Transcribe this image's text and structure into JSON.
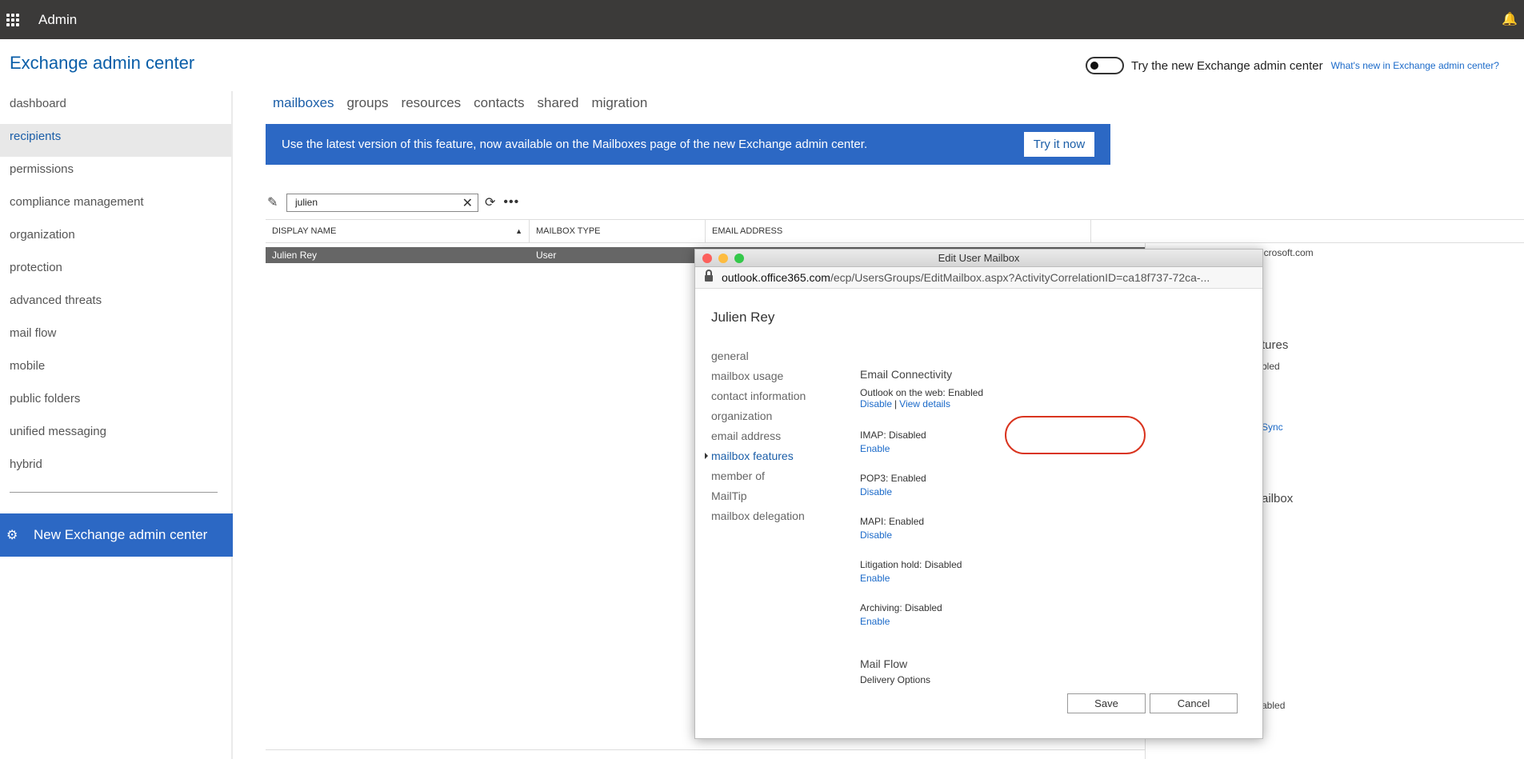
{
  "topbar": {
    "app_title": "Admin",
    "bell_glyph": "🔔"
  },
  "header": {
    "title": "Exchange admin center",
    "toggle_label": "Try the new Exchange admin center",
    "whats_new": "What's new in Exchange admin center?"
  },
  "nav": {
    "items": [
      "dashboard",
      "recipients",
      "permissions",
      "compliance management",
      "organization",
      "protection",
      "advanced threats",
      "mail flow",
      "mobile",
      "public folders",
      "unified messaging",
      "hybrid"
    ],
    "active": "recipients",
    "new_eac": "New Exchange admin center"
  },
  "tabs": {
    "items": [
      "mailboxes",
      "groups",
      "resources",
      "contacts",
      "shared",
      "migration"
    ],
    "active": "mailboxes"
  },
  "banner": {
    "text": "Use the latest version of this feature, now available on the Mailboxes page of the new Exchange admin center.",
    "button": "Try it now"
  },
  "toolbar": {
    "search_value": "julien"
  },
  "table": {
    "columns": [
      "DISPLAY NAME",
      "MAILBOX TYPE",
      "EMAIL ADDRESS"
    ],
    "rows": [
      {
        "display_name": "Julien Rey",
        "mailbox_type": "User"
      }
    ]
  },
  "background_details": {
    "email_partial": "icrosoft.com",
    "features_partial": "tures",
    "enabled_partial": "bled",
    "sync_partial": "Sync",
    "mailbox_partial": "ailbox",
    "enabled_partial_2": "abled"
  },
  "modal": {
    "window_title": "Edit User Mailbox",
    "url_host": "outlook.office365.com",
    "url_path": "/ecp/UsersGroups/EditMailbox.aspx?ActivityCorrelationID=ca18f737-72ca-...",
    "user_name": "Julien Rey",
    "nav_items": [
      "general",
      "mailbox usage",
      "contact information",
      "organization",
      "email address",
      "mailbox features",
      "member of",
      "MailTip",
      "mailbox delegation"
    ],
    "active_nav": "mailbox features",
    "email_connectivity": "Email Connectivity",
    "owa_status": "Outlook on the web: Enabled",
    "owa_disable": "Disable",
    "owa_sep": "|",
    "owa_details": "View details",
    "imap_status": "IMAP: Disabled",
    "imap_action": "Enable",
    "pop3_status": "POP3: Enabled",
    "pop3_action": "Disable",
    "mapi_status": "MAPI: Enabled",
    "mapi_action": "Disable",
    "litigation_status": "Litigation hold: Disabled",
    "litigation_action": "Enable",
    "archiving_status": "Archiving: Disabled",
    "archiving_action": "Enable",
    "mail_flow": "Mail Flow",
    "delivery_options": "Delivery Options",
    "save": "Save",
    "cancel": "Cancel"
  },
  "colors": {
    "accent": "#2c68c4",
    "topbar": "#3b3a39",
    "highlight": "#d9341f",
    "link": "#1b6ac9"
  }
}
